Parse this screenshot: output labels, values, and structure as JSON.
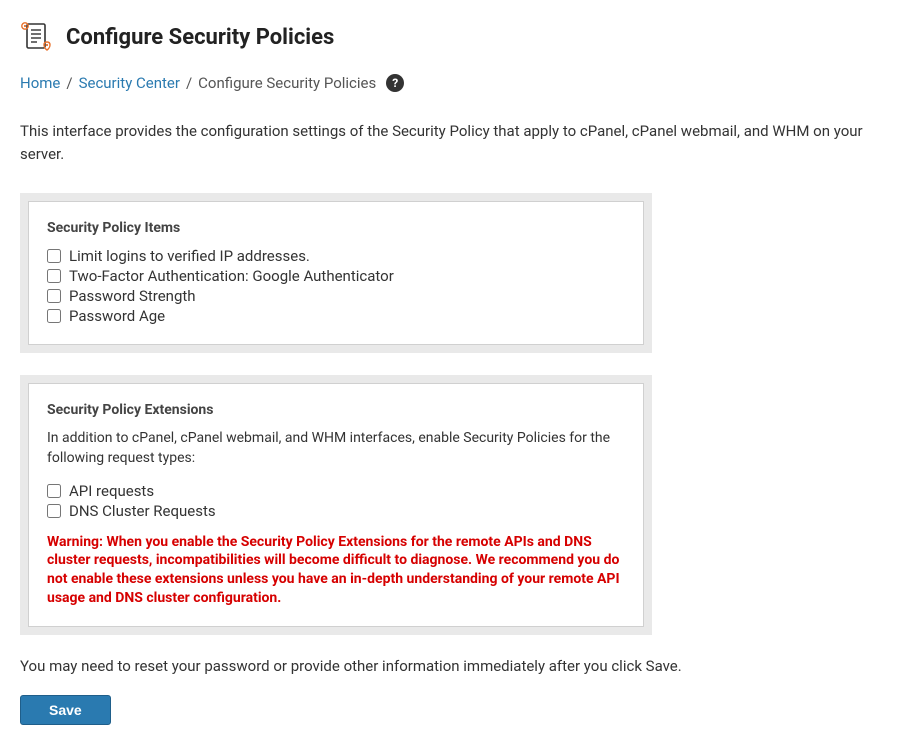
{
  "header": {
    "title": "Configure Security Policies"
  },
  "breadcrumb": {
    "home": "Home",
    "security_center": "Security Center",
    "current": "Configure Security Policies"
  },
  "intro": "This interface provides the configuration settings of the Security Policy that apply to cPanel, cPanel webmail, and WHM on your server.",
  "items_panel": {
    "title": "Security Policy Items",
    "items": {
      "0": {
        "label": "Limit logins to verified IP addresses."
      },
      "1": {
        "label": "Two-Factor Authentication: Google Authenticator"
      },
      "2": {
        "label": "Password Strength"
      },
      "3": {
        "label": "Password Age"
      }
    }
  },
  "extensions_panel": {
    "title": "Security Policy Extensions",
    "desc": "In addition to cPanel, cPanel webmail, and WHM interfaces, enable Security Policies for the following request types:",
    "items": {
      "0": {
        "label": "API requests"
      },
      "1": {
        "label": "DNS Cluster Requests"
      }
    },
    "warning": "Warning: When you enable the Security Policy Extensions for the remote APIs and DNS cluster requests, incompatibilities will become difficult to diagnose. We recommend you do not enable these extensions unless you have an in-depth understanding of your remote API usage and DNS cluster configuration."
  },
  "note": "You may need to reset your password or provide other information immediately after you click Save.",
  "buttons": {
    "save": "Save"
  }
}
